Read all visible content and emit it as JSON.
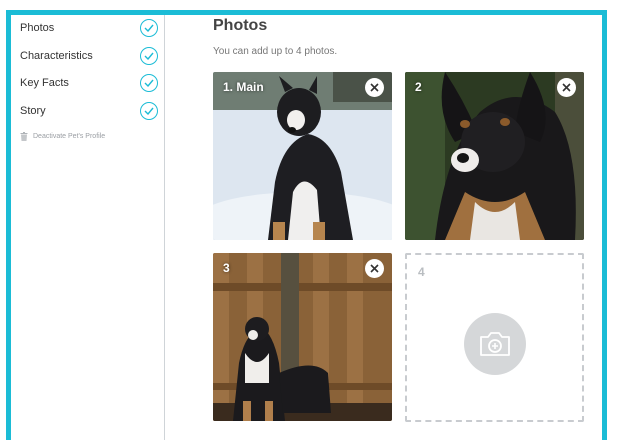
{
  "sidebar": {
    "items": [
      {
        "label": "Photos"
      },
      {
        "label": "Characteristics"
      },
      {
        "label": "Key Facts"
      },
      {
        "label": "Story"
      }
    ],
    "deactivate_label": "Deactivate Pet's Profile"
  },
  "main": {
    "title": "Photos",
    "subtitle": "You can add up to 4 photos.",
    "photos": [
      {
        "label": "1. Main"
      },
      {
        "label": "2"
      },
      {
        "label": "3"
      }
    ],
    "empty_slot": {
      "label": "4"
    }
  },
  "colors": {
    "accent": "#1bbcd6",
    "placeholder": "#d5d7d9"
  },
  "icons": [
    "check-circle-icon",
    "trash-icon",
    "close-icon",
    "camera-add-icon"
  ]
}
